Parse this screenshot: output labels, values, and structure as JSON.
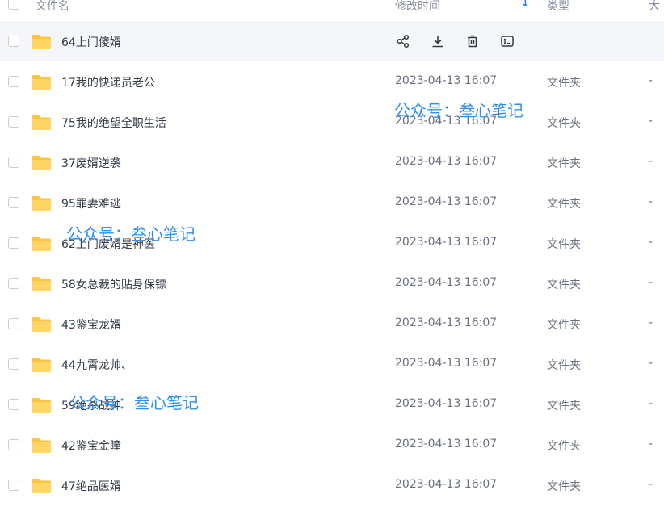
{
  "header": {
    "name_label": "文件名",
    "time_label": "修改时间",
    "sort_glyph": "↓",
    "type_label": "类型",
    "size_label": "大"
  },
  "rows": [
    {
      "name": "64上门傻婿",
      "time": "",
      "type": "",
      "size": "",
      "hover": true
    },
    {
      "name": "17我的快递员老公",
      "time": "2023-04-13 16:07",
      "type": "文件夹",
      "size": "-"
    },
    {
      "name": "75我的绝望全职生活",
      "time": "2023-04-13 16:07",
      "type": "文件夹",
      "size": "-"
    },
    {
      "name": "37废婿逆袭",
      "time": "2023-04-13 16:07",
      "type": "文件夹",
      "size": "-"
    },
    {
      "name": "95罪妻难逃",
      "time": "2023-04-13 16:07",
      "type": "文件夹",
      "size": "-"
    },
    {
      "name": "62上门废婿是神医",
      "time": "2023-04-13 16:07",
      "type": "文件夹",
      "size": "-"
    },
    {
      "name": "58女总裁的贴身保镖",
      "time": "2023-04-13 16:07",
      "type": "文件夹",
      "size": "-"
    },
    {
      "name": "43鉴宝龙婿",
      "time": "2023-04-13 16:07",
      "type": "文件夹",
      "size": "-"
    },
    {
      "name": "44九霄龙帅、",
      "time": "2023-04-13 16:07",
      "type": "文件夹",
      "size": "-"
    },
    {
      "name": "59绝杀战神",
      "time": "2023-04-13 16:07",
      "type": "文件夹",
      "size": "-"
    },
    {
      "name": "42鉴宝金瞳",
      "time": "2023-04-13 16:07",
      "type": "文件夹",
      "size": "-"
    },
    {
      "name": "47绝品医婿",
      "time": "2023-04-13 16:07",
      "type": "文件夹",
      "size": "-"
    }
  ],
  "row_actions": [
    "share-icon",
    "download-icon",
    "delete-icon",
    "rename-icon"
  ],
  "watermarks": [
    "公众号：叁心笔记",
    "公众号：叁心笔记",
    "公众号：叁心笔记"
  ],
  "colors": {
    "folder": "#ffc53d",
    "accent": "#2c7cf6",
    "watermark": "#2f8ff0"
  }
}
